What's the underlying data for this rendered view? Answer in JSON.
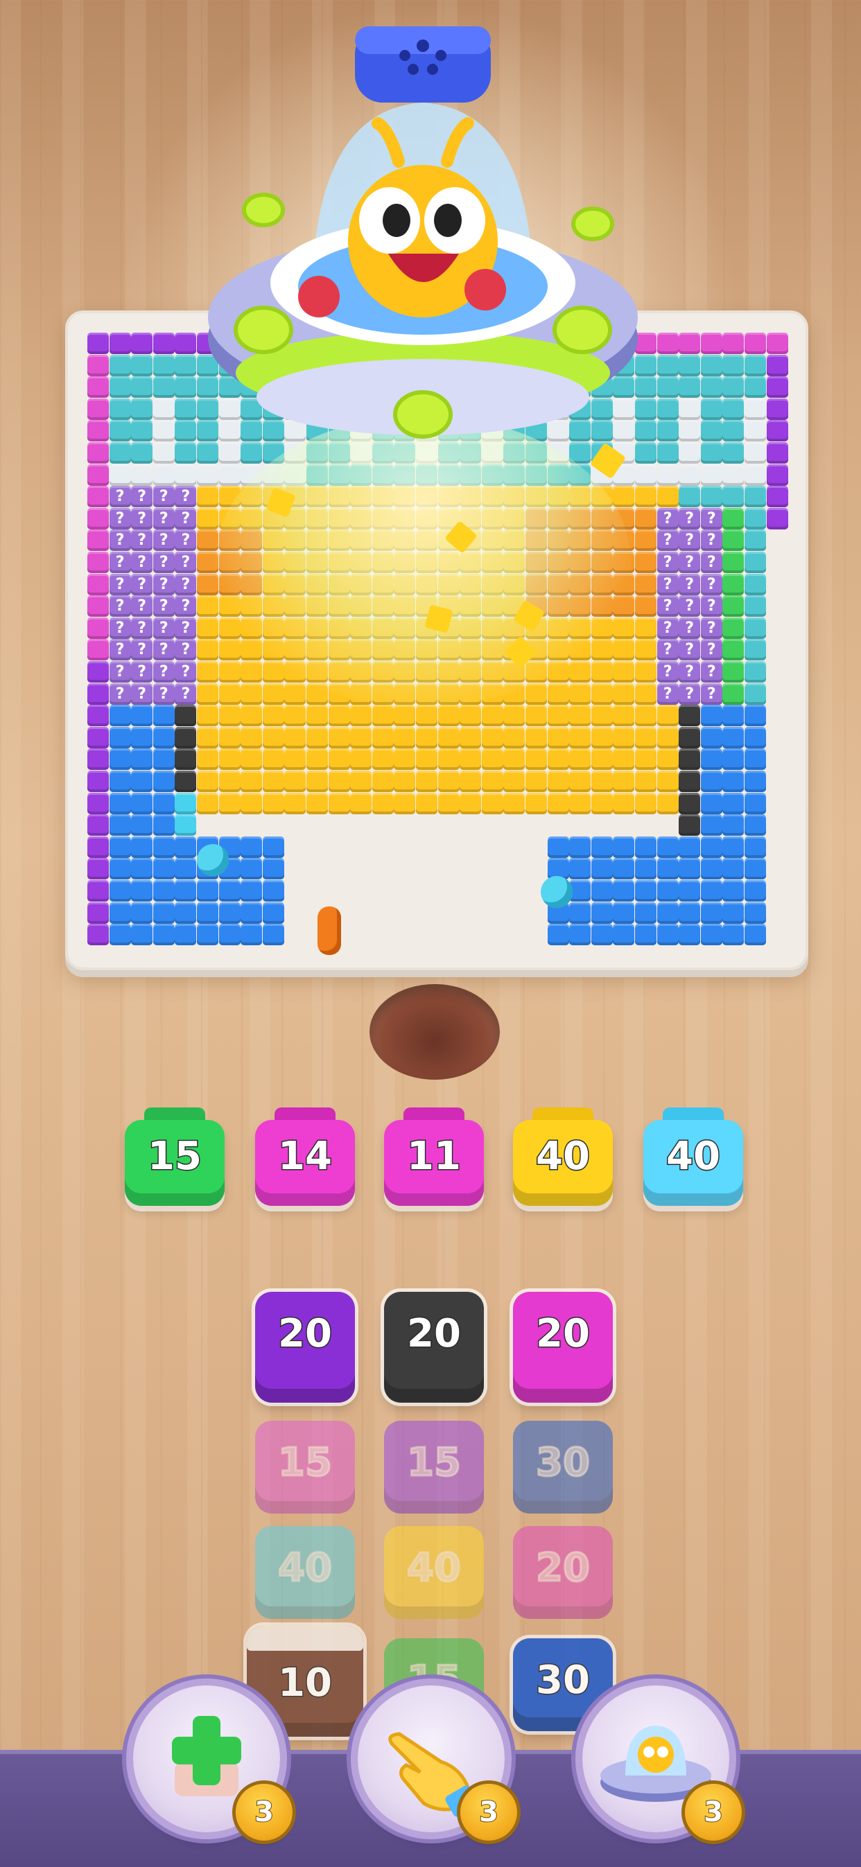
{
  "board": {
    "cols": 32,
    "rows": 28
  },
  "jars": [
    {
      "value": "15",
      "color": "#2fd35a",
      "cap": "#29b84f"
    },
    {
      "value": "14",
      "color": "#ee3ed2",
      "cap": "#d02ab6"
    },
    {
      "value": "11",
      "color": "#ee3ed2",
      "cap": "#d02ab6"
    },
    {
      "value": "40",
      "color": "#ffd21f",
      "cap": "#f0bf10"
    },
    {
      "value": "40",
      "color": "#5dd8ff",
      "cap": "#3fc4ee"
    }
  ],
  "queue": {
    "row1": [
      {
        "value": "20",
        "color": "#8a2fd6"
      },
      {
        "value": "20",
        "color": "#3d3d3d"
      },
      {
        "value": "20",
        "color": "#e43ad0"
      }
    ],
    "row2": [
      {
        "value": "15",
        "color": "#e05fd0"
      },
      {
        "value": "15",
        "color": "#9a4be0"
      },
      {
        "value": "30",
        "color": "#2e63c9"
      }
    ],
    "row3": [
      {
        "value": "40",
        "color": "#5fcfe0"
      },
      {
        "value": "40",
        "color": "#ffd632"
      },
      {
        "value": "20",
        "color": "#e04cb8"
      }
    ],
    "row4": [
      {
        "value": "10",
        "color": "#7a4a3a"
      },
      {
        "value": "15",
        "color": "#2fc24f"
      },
      {
        "value": "30",
        "color": "#2b5fc7"
      }
    ]
  },
  "boosters": [
    {
      "icon": "plus-icon",
      "count": "3"
    },
    {
      "icon": "hand-icon",
      "count": "3"
    },
    {
      "icon": "ufo-icon",
      "count": "3"
    }
  ]
}
